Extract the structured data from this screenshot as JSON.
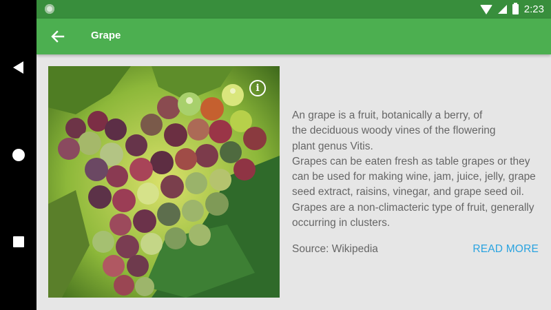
{
  "statusbar": {
    "time": "2:23",
    "icons": [
      "wifi-icon",
      "cell-signal-icon",
      "battery-charging-icon"
    ]
  },
  "toolbar": {
    "back_icon": "arrow-back-icon",
    "title": "Grape"
  },
  "image": {
    "icon": "info-icon",
    "info_glyph": "i"
  },
  "content": {
    "description_lines": [
      "An grape is a fruit, botanically a berry, of",
      "the deciduous woody vines of the flowering",
      "plant genus Vitis.",
      "Grapes can be eaten fresh as table grapes or they",
      "can be used for making wine, jam, juice, jelly, grape",
      "seed extract, raisins, vinegar, and grape seed oil.",
      "Grapes are a non-climacteric type of fruit, generally",
      "occurring in clusters."
    ],
    "source": "Source: Wikipedia",
    "read_more": "READ MORE"
  },
  "navigation": {
    "icons": [
      "back-triangle-icon",
      "home-circle-icon",
      "recents-square-icon"
    ]
  },
  "colors": {
    "statusbar": "#388e3c",
    "toolbar": "#4caf50",
    "accent": "#29a3e0",
    "background": "#e6e6e6"
  }
}
